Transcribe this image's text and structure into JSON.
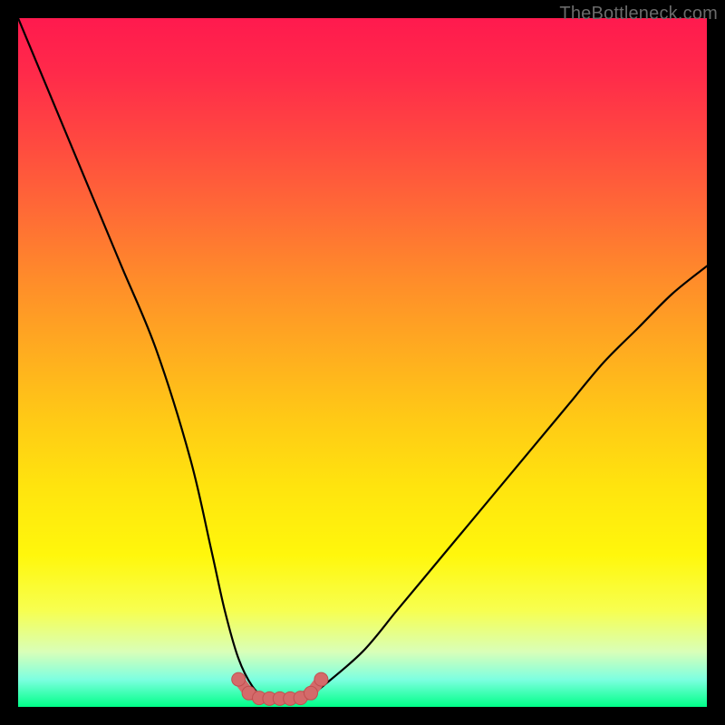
{
  "watermark": "TheBottleneck.com",
  "colors": {
    "gradient_top": "#ff1a4e",
    "gradient_mid": "#ffe40e",
    "gradient_bottom": "#00ff88",
    "curve_stroke": "#000000",
    "marker_fill": "#d46a6a",
    "marker_stroke": "#c05050",
    "frame": "#000000"
  },
  "chart_data": {
    "type": "line",
    "title": "",
    "xlabel": "",
    "ylabel": "",
    "xlim": [
      0,
      100
    ],
    "ylim": [
      0,
      100
    ],
    "series": [
      {
        "name": "curve",
        "x": [
          0,
          5,
          10,
          15,
          20,
          25,
          28,
          30,
          32,
          34,
          36,
          38,
          40,
          42,
          44,
          50,
          55,
          60,
          65,
          70,
          75,
          80,
          85,
          90,
          95,
          100
        ],
        "y": [
          100,
          88,
          76,
          64,
          52,
          36,
          23,
          14,
          7,
          3,
          1.2,
          1.2,
          1.2,
          1.2,
          2.8,
          8,
          14,
          20,
          26,
          32,
          38,
          44,
          50,
          55,
          60,
          64
        ]
      }
    ],
    "markers": {
      "name": "bottom-markers",
      "x": [
        32,
        33.5,
        35,
        36.5,
        38,
        39.5,
        41,
        42.5,
        44
      ],
      "y": [
        4,
        2,
        1.3,
        1.2,
        1.2,
        1.2,
        1.3,
        2,
        4
      ]
    }
  }
}
